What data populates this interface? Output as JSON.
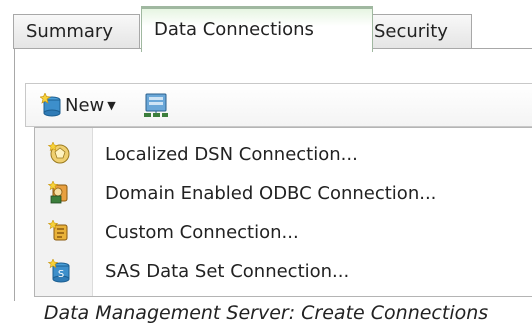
{
  "tabs": [
    {
      "label": "Summary"
    },
    {
      "label": "Data Connections"
    },
    {
      "label": "Security"
    }
  ],
  "toolbar": {
    "new_label": "New",
    "new_icon": "cylinder-star-icon",
    "second_icon": "database-network-icon"
  },
  "menu": {
    "items": [
      {
        "label": "Localized DSN Connection...",
        "icon": "localized-dsn-icon"
      },
      {
        "label": "Domain Enabled ODBC Connection...",
        "icon": "domain-odbc-icon"
      },
      {
        "label": "Custom Connection...",
        "icon": "custom-connection-icon"
      },
      {
        "label": "SAS Data Set Connection...",
        "icon": "sas-data-set-icon"
      }
    ]
  },
  "caption": "Data Management Server: Create Connections",
  "colors": {
    "active_tab_accent": "#8ec98a",
    "border": "#a8a8a8",
    "menu_gutter": "#f2f2f2"
  }
}
